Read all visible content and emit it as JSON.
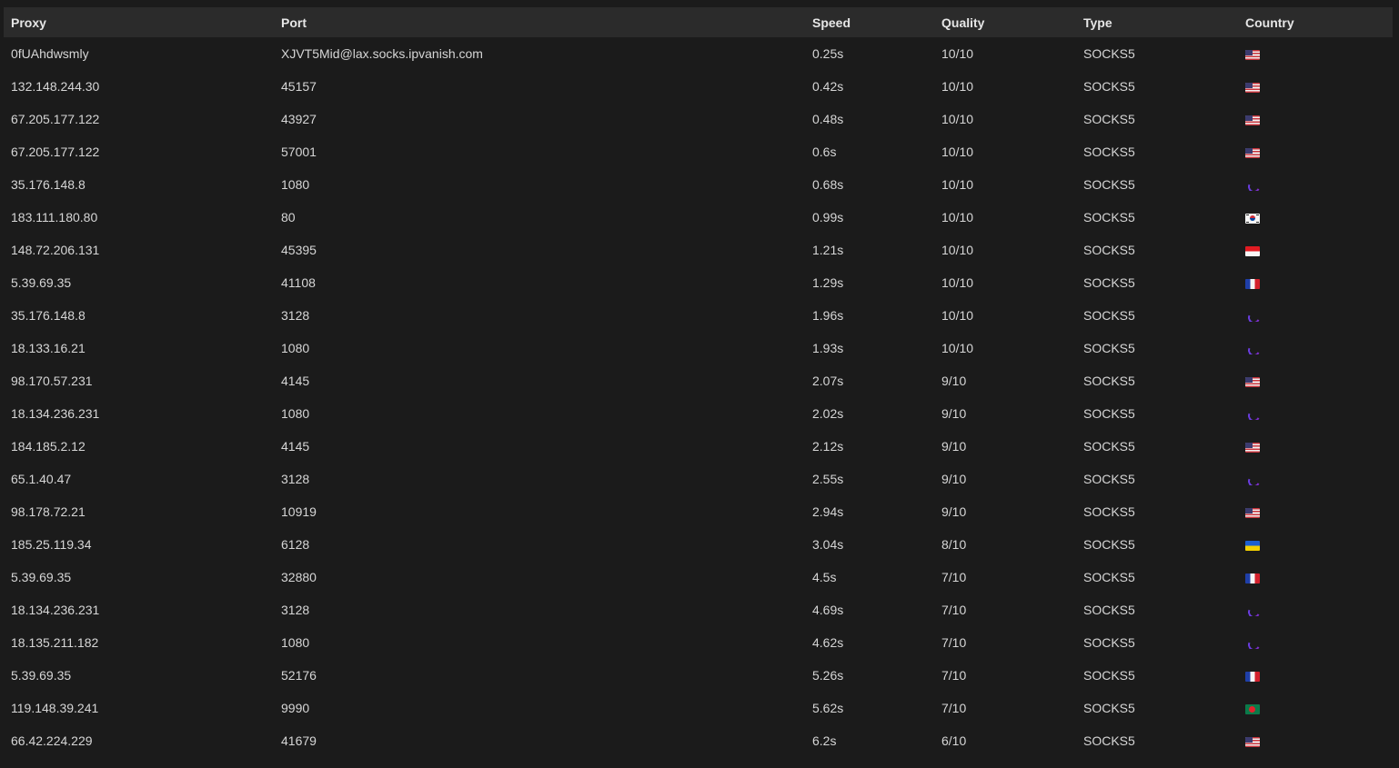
{
  "table": {
    "columns": [
      "Proxy",
      "Port",
      "Speed",
      "Quality",
      "Type",
      "Country"
    ],
    "rows": [
      {
        "proxy": "0fUAhdwsmly",
        "port": "XJVT5Mid@lax.socks.ipvanish.com",
        "speed": "0.25s",
        "quality": "10/10",
        "type": "SOCKS5",
        "country_icon": "us-flag-icon"
      },
      {
        "proxy": "132.148.244.30",
        "port": "45157",
        "speed": "0.42s",
        "quality": "10/10",
        "type": "SOCKS5",
        "country_icon": "us-flag-icon"
      },
      {
        "proxy": "67.205.177.122",
        "port": "43927",
        "speed": "0.48s",
        "quality": "10/10",
        "type": "SOCKS5",
        "country_icon": "us-flag-icon"
      },
      {
        "proxy": "67.205.177.122",
        "port": "57001",
        "speed": "0.6s",
        "quality": "10/10",
        "type": "SOCKS5",
        "country_icon": "us-flag-icon"
      },
      {
        "proxy": "35.176.148.8",
        "port": "1080",
        "speed": "0.68s",
        "quality": "10/10",
        "type": "SOCKS5",
        "country_icon": "unknown-flag-icon"
      },
      {
        "proxy": "183.111.180.80",
        "port": "80",
        "speed": "0.99s",
        "quality": "10/10",
        "type": "SOCKS5",
        "country_icon": "kr-flag-icon"
      },
      {
        "proxy": "148.72.206.131",
        "port": "45395",
        "speed": "1.21s",
        "quality": "10/10",
        "type": "SOCKS5",
        "country_icon": "id-flag-icon"
      },
      {
        "proxy": "5.39.69.35",
        "port": "41108",
        "speed": "1.29s",
        "quality": "10/10",
        "type": "SOCKS5",
        "country_icon": "fr-flag-icon"
      },
      {
        "proxy": "35.176.148.8",
        "port": "3128",
        "speed": "1.96s",
        "quality": "10/10",
        "type": "SOCKS5",
        "country_icon": "unknown-flag-icon"
      },
      {
        "proxy": "18.133.16.21",
        "port": "1080",
        "speed": "1.93s",
        "quality": "10/10",
        "type": "SOCKS5",
        "country_icon": "unknown-flag-icon"
      },
      {
        "proxy": "98.170.57.231",
        "port": "4145",
        "speed": "2.07s",
        "quality": "9/10",
        "type": "SOCKS5",
        "country_icon": "us-flag-icon"
      },
      {
        "proxy": "18.134.236.231",
        "port": "1080",
        "speed": "2.02s",
        "quality": "9/10",
        "type": "SOCKS5",
        "country_icon": "unknown-flag-icon"
      },
      {
        "proxy": "184.185.2.12",
        "port": "4145",
        "speed": "2.12s",
        "quality": "9/10",
        "type": "SOCKS5",
        "country_icon": "us-flag-icon"
      },
      {
        "proxy": "65.1.40.47",
        "port": "3128",
        "speed": "2.55s",
        "quality": "9/10",
        "type": "SOCKS5",
        "country_icon": "unknown-flag-icon"
      },
      {
        "proxy": "98.178.72.21",
        "port": "10919",
        "speed": "2.94s",
        "quality": "9/10",
        "type": "SOCKS5",
        "country_icon": "us-flag-icon"
      },
      {
        "proxy": "185.25.119.34",
        "port": "6128",
        "speed": "3.04s",
        "quality": "8/10",
        "type": "SOCKS5",
        "country_icon": "ua-flag-icon"
      },
      {
        "proxy": "5.39.69.35",
        "port": "32880",
        "speed": "4.5s",
        "quality": "7/10",
        "type": "SOCKS5",
        "country_icon": "fr-flag-icon"
      },
      {
        "proxy": "18.134.236.231",
        "port": "3128",
        "speed": "4.69s",
        "quality": "7/10",
        "type": "SOCKS5",
        "country_icon": "unknown-flag-icon"
      },
      {
        "proxy": "18.135.211.182",
        "port": "1080",
        "speed": "4.62s",
        "quality": "7/10",
        "type": "SOCKS5",
        "country_icon": "unknown-flag-icon"
      },
      {
        "proxy": "5.39.69.35",
        "port": "52176",
        "speed": "5.26s",
        "quality": "7/10",
        "type": "SOCKS5",
        "country_icon": "fr-flag-icon"
      },
      {
        "proxy": "119.148.39.241",
        "port": "9990",
        "speed": "5.62s",
        "quality": "7/10",
        "type": "SOCKS5",
        "country_icon": "bd-flag-icon"
      },
      {
        "proxy": "66.42.224.229",
        "port": "41679",
        "speed": "6.2s",
        "quality": "6/10",
        "type": "SOCKS5",
        "country_icon": "us-flag-icon"
      }
    ]
  },
  "colors": {
    "background": "#1b1b1b",
    "header_background": "#2b2b2b",
    "header_text": "#e6e6e6",
    "cell_text": "#d6d6d6"
  }
}
